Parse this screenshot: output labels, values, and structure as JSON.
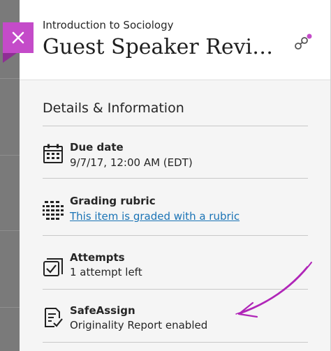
{
  "header": {
    "course_name": "Introduction to Sociology",
    "title": "Guest Speaker Revi…",
    "close_icon": "close-icon",
    "help_icon": "help-icon"
  },
  "details": {
    "section_title": "Details & Information",
    "items": [
      {
        "icon": "calendar-icon",
        "label": "Due date",
        "value": "9/7/17, 12:00 AM (EDT)"
      },
      {
        "icon": "rubric-icon",
        "label": "Grading rubric",
        "link": "This item is graded with a rubric"
      },
      {
        "icon": "attempts-icon",
        "label": "Attempts",
        "value": "1 attempt left"
      },
      {
        "icon": "safeassign-icon",
        "label": "SafeAssign",
        "value": "Originality Report enabled"
      }
    ]
  },
  "colors": {
    "accent": "#c44bc9",
    "link": "#1a73b5",
    "annotation_arrow": "#b026b8"
  }
}
